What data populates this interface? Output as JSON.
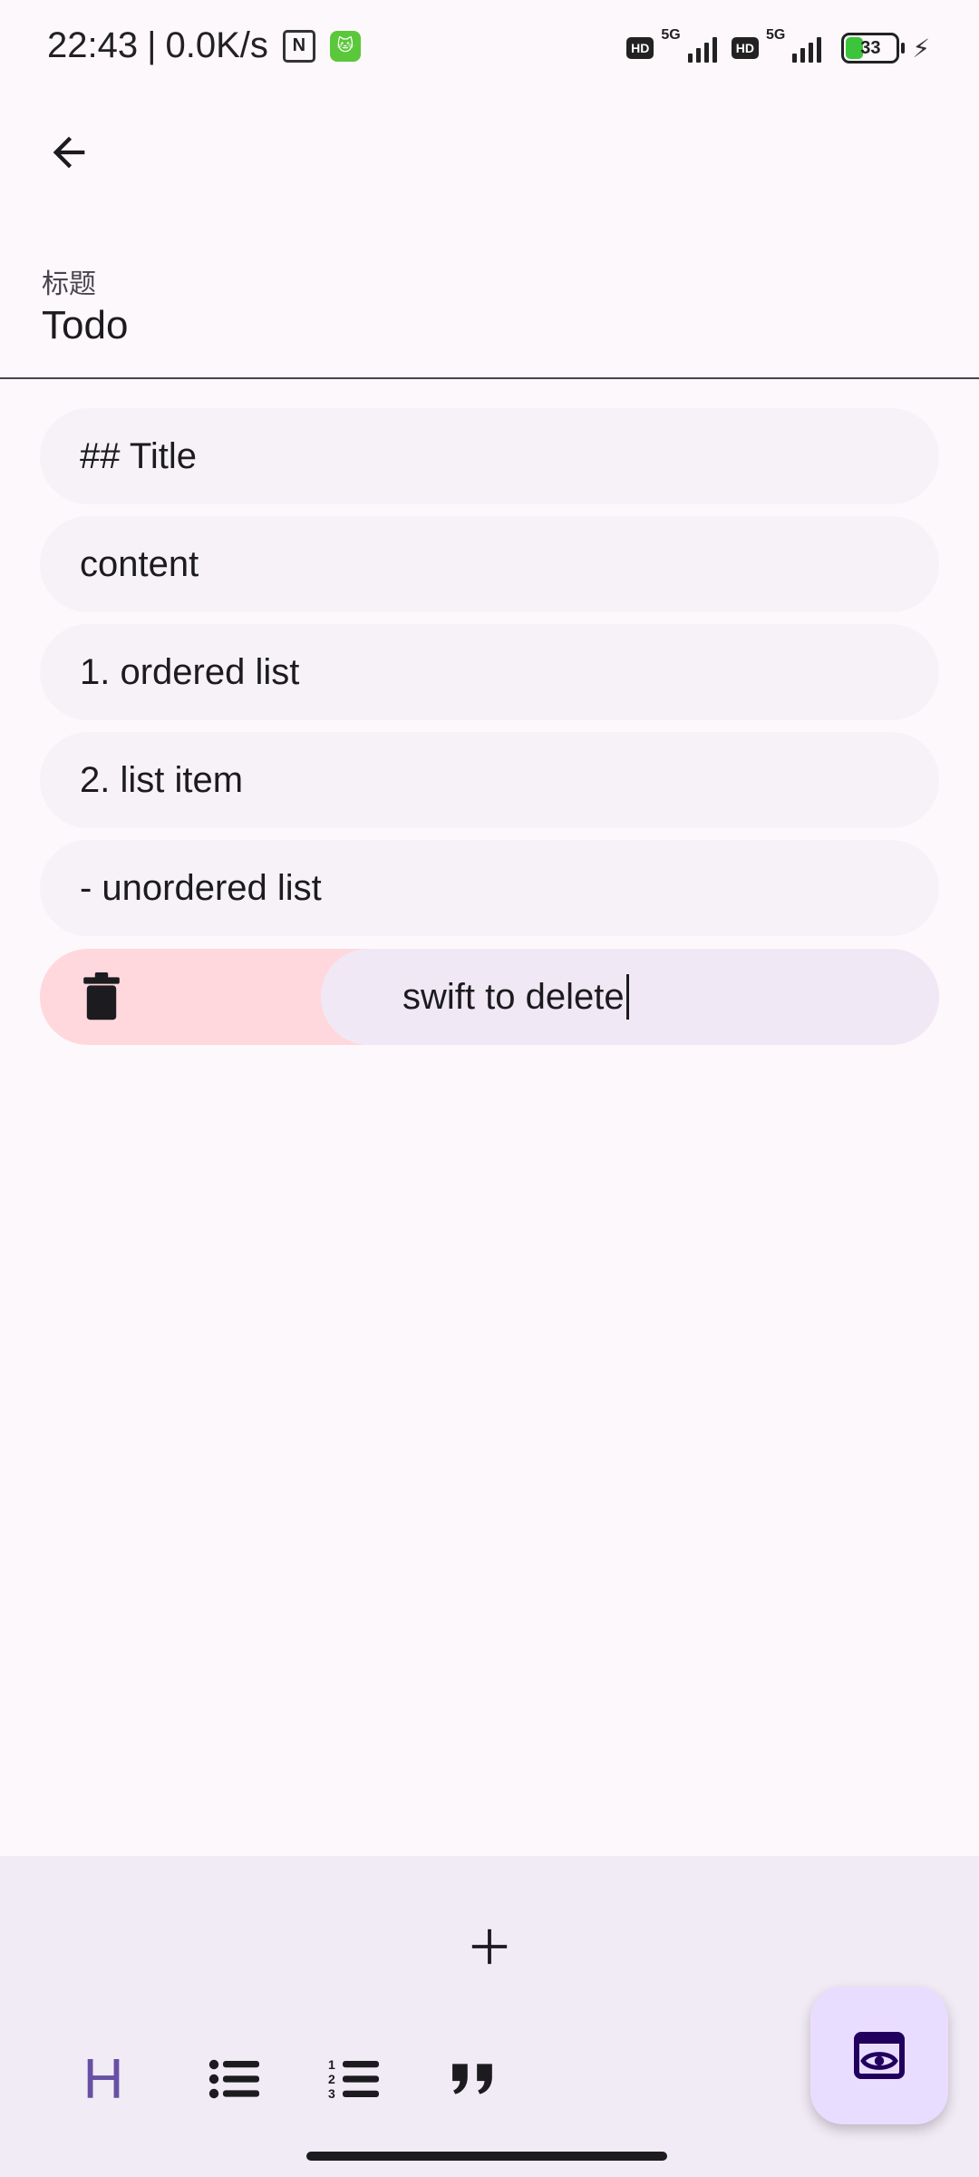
{
  "status_bar": {
    "time": "22:43",
    "separator": "|",
    "speed": "0.0K/s",
    "nfc_icon": "N",
    "app_icon": "cat-icon",
    "hd1": "HD",
    "net1": "5G",
    "hd2": "HD",
    "net2": "5G",
    "battery_level": "33"
  },
  "header": {
    "back_icon": "arrow-left-icon"
  },
  "title_field": {
    "label": "标题",
    "value": "Todo"
  },
  "blocks": [
    {
      "text": "## Title"
    },
    {
      "text": "content"
    },
    {
      "text": "1. ordered list"
    },
    {
      "text": "2. list item"
    },
    {
      "text": "- unordered list"
    }
  ],
  "swipe_block": {
    "text": "swift to delete",
    "action_icon": "trash-icon"
  },
  "toolbar": {
    "add_icon": "plus-icon",
    "heading_label": "H",
    "bullet_list_icon": "bullet-list-icon",
    "numbered_list_icon": "numbered-list-icon",
    "quote_icon": "quote-icon",
    "preview_icon": "preview-eye-icon"
  },
  "colors": {
    "background": "#fdf8fc",
    "block": "#f7f2f7",
    "swipe_delete": "#ffd8dd",
    "swipe_active": "#f0e9f5",
    "toolbar": "#f1ebf5",
    "accent": "#6750a4",
    "fab": "#e9ddff"
  }
}
